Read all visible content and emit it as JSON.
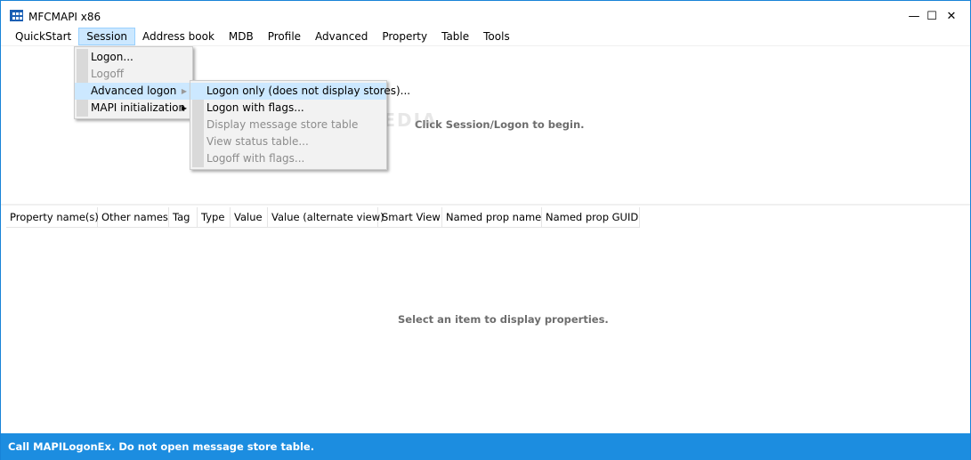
{
  "window": {
    "title": "MFCMAPI x86"
  },
  "menubar": {
    "items": [
      {
        "label": "QuickStart"
      },
      {
        "label": "Session"
      },
      {
        "label": "Address book"
      },
      {
        "label": "MDB"
      },
      {
        "label": "Profile"
      },
      {
        "label": "Advanced"
      },
      {
        "label": "Property"
      },
      {
        "label": "Table"
      },
      {
        "label": "Tools"
      }
    ]
  },
  "session_menu": {
    "items": [
      {
        "label": "Logon...",
        "enabled": true
      },
      {
        "label": "Logoff",
        "enabled": false
      },
      {
        "label": "Advanced logon",
        "enabled": true,
        "submenu": true
      },
      {
        "label": "MAPI initialization",
        "enabled": true,
        "submenu": true
      }
    ]
  },
  "advanced_logon_menu": {
    "items": [
      {
        "label": "Logon only (does not display stores)...",
        "enabled": true
      },
      {
        "label": "Logon with flags...",
        "enabled": true
      },
      {
        "label": "Display message store table",
        "enabled": false
      },
      {
        "label": "View status table...",
        "enabled": false
      },
      {
        "label": "Logoff with flags...",
        "enabled": false
      }
    ]
  },
  "upper_pane": {
    "hint": "Click Session/Logon to begin."
  },
  "property_list": {
    "columns": [
      "Property name(s)",
      "Other names",
      "Tag",
      "Type",
      "Value",
      "Value (alternate view)",
      "Smart View",
      "Named prop name",
      "Named prop GUID"
    ],
    "hint": "Select an item to display properties."
  },
  "statusbar": {
    "text": "Call MAPILogonEx. Do not open message store table."
  },
  "watermark": {
    "text": "SOFTPEDIA"
  },
  "colors": {
    "accent": "#1c8de0",
    "highlight": "#cce8ff"
  }
}
